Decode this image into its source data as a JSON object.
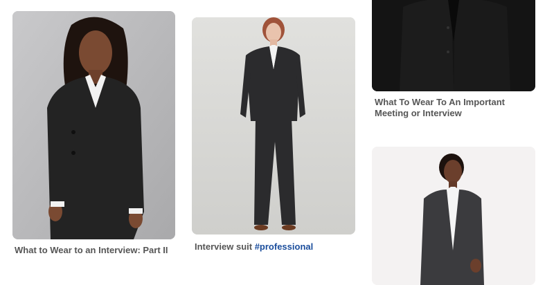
{
  "feed": {
    "pins": [
      {
        "title": "What to Wear to an Interview: Part II",
        "image_label": "photo-woman-black-blazer-curly-hair",
        "background": "#bdbdbf"
      },
      {
        "title_text": "Interview suit ",
        "title_hashtag": "#professional",
        "image_label": "photo-woman-black-pantsuit-full-length",
        "background": "#dcdcd9"
      },
      {
        "title": "What To Wear To An Important Meeting or Interview",
        "image_label": "photo-dark-suit-closeup",
        "background": "#111111"
      },
      {
        "title": "",
        "image_label": "photo-woman-grey-suit-white-shirt",
        "background": "#f3f1f1"
      }
    ]
  },
  "colors": {
    "text": "#555555",
    "hashtag": "#1a4d9c"
  }
}
